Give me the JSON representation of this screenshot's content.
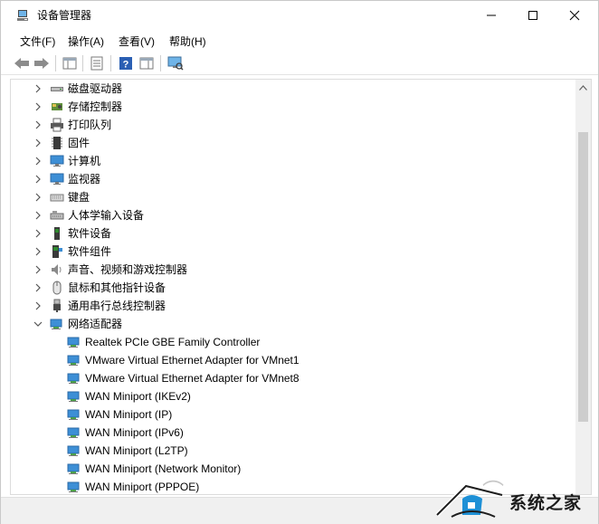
{
  "window": {
    "title": "设备管理器"
  },
  "window_controls": {
    "minimize": "—",
    "maximize": "☐",
    "close": "✕"
  },
  "menu": [
    {
      "label": "文件(F)"
    },
    {
      "label": "操作(A)"
    },
    {
      "label": "查看(V)"
    },
    {
      "label": "帮助(H)"
    }
  ],
  "toolbar": {
    "buttons": [
      "back-icon",
      "forward-icon",
      "show-hide-tree-icon",
      "properties-icon",
      "help-icon",
      "action-pane-icon",
      "scan-hardware-icon"
    ]
  },
  "tree": {
    "categories": [
      {
        "label": "磁盘驱动器",
        "icon": "disk-drive-icon",
        "expanded": false
      },
      {
        "label": "存储控制器",
        "icon": "storage-controller-icon",
        "expanded": false
      },
      {
        "label": "打印队列",
        "icon": "printer-icon",
        "expanded": false
      },
      {
        "label": "固件",
        "icon": "firmware-icon",
        "expanded": false
      },
      {
        "label": "计算机",
        "icon": "computer-icon",
        "expanded": false
      },
      {
        "label": "监视器",
        "icon": "monitor-icon",
        "expanded": false
      },
      {
        "label": "键盘",
        "icon": "keyboard-icon",
        "expanded": false
      },
      {
        "label": "人体学输入设备",
        "icon": "hid-icon",
        "expanded": false
      },
      {
        "label": "软件设备",
        "icon": "software-device-icon",
        "expanded": false
      },
      {
        "label": "软件组件",
        "icon": "software-component-icon",
        "expanded": false
      },
      {
        "label": "声音、视频和游戏控制器",
        "icon": "audio-icon",
        "expanded": false
      },
      {
        "label": "鼠标和其他指针设备",
        "icon": "mouse-icon",
        "expanded": false
      },
      {
        "label": "通用串行总线控制器",
        "icon": "usb-icon",
        "expanded": false
      },
      {
        "label": "网络适配器",
        "icon": "network-adapter-icon",
        "expanded": true
      }
    ],
    "network_adapters": [
      "Realtek PCIe GBE Family Controller",
      "VMware Virtual Ethernet Adapter for VMnet1",
      "VMware Virtual Ethernet Adapter for VMnet8",
      "WAN Miniport (IKEv2)",
      "WAN Miniport (IP)",
      "WAN Miniport (IPv6)",
      "WAN Miniport (L2TP)",
      "WAN Miniport (Network Monitor)",
      "WAN Miniport (PPPOE)"
    ]
  },
  "watermark": {
    "text": "系统之家"
  },
  "colors": {
    "accent": "#1e90d6",
    "thumb": "#cdcdcd"
  }
}
